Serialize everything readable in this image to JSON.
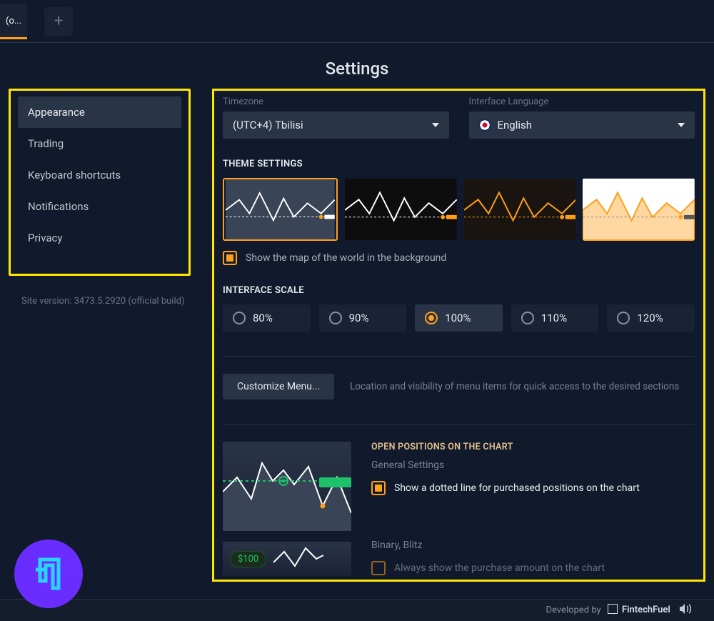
{
  "topbar": {
    "tab_label": "(o...",
    "plus_label": "+"
  },
  "page_title": "Settings",
  "sidebar": {
    "items": [
      {
        "label": "Appearance",
        "active": true
      },
      {
        "label": "Trading",
        "active": false
      },
      {
        "label": "Keyboard shortcuts",
        "active": false
      },
      {
        "label": "Notifications",
        "active": false
      },
      {
        "label": "Privacy",
        "active": false
      }
    ]
  },
  "version_text": "Site version: 3473.5.2920 (official build)",
  "main": {
    "timezone": {
      "label": "Timezone",
      "value": "(UTC+4) Tbilisi"
    },
    "language": {
      "label": "Interface Language",
      "value": "English"
    },
    "theme_section_title": "THEME SETTINGS",
    "show_map_label": "Show the map of the world in the background",
    "scale_section_title": "INTERFACE SCALE",
    "scales": [
      "80%",
      "90%",
      "100%",
      "110%",
      "120%"
    ],
    "selected_scale": "100%",
    "customize_btn": "Customize Menu...",
    "customize_hint": "Location and visibility of menu items for quick access to the desired sections",
    "open_positions": {
      "title": "OPEN POSITIONS ON THE CHART",
      "general": "General Settings",
      "checkbox_label": "Show a dotted line for purchased positions on the chart"
    },
    "binary": {
      "title": "Binary, Blitz",
      "amount": "$100",
      "checkbox_label": "Always show the purchase amount on the chart"
    }
  },
  "footer": {
    "text": "Developed by",
    "brand": "FintechFuel"
  }
}
